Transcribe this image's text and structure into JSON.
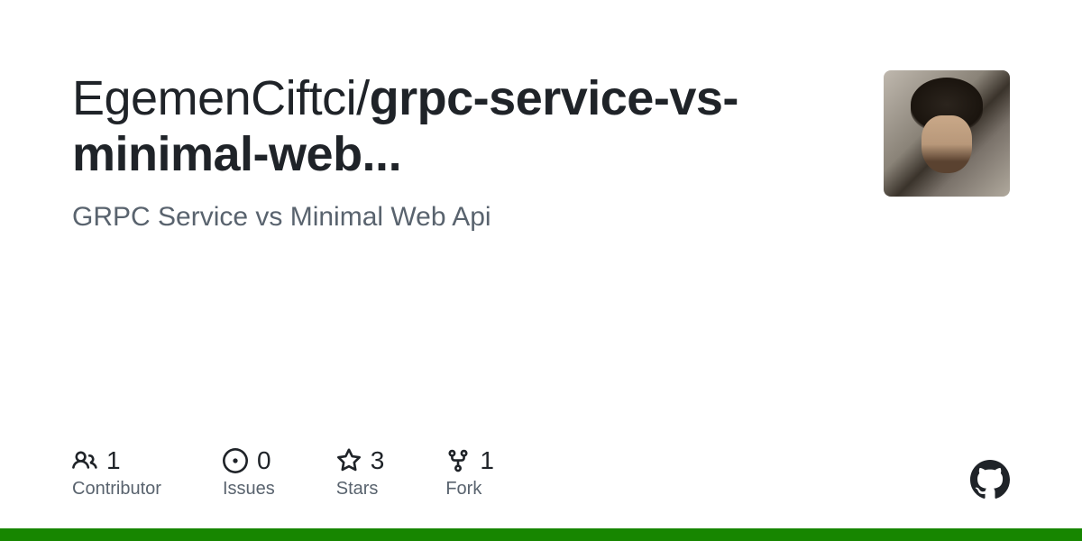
{
  "repo": {
    "owner": "EgemenCiftci",
    "separator": "/",
    "name": "grpc-service-vs-minimal-web...",
    "description": "GRPC Service vs Minimal Web Api"
  },
  "stats": {
    "contributors": {
      "value": "1",
      "label": "Contributor"
    },
    "issues": {
      "value": "0",
      "label": "Issues"
    },
    "stars": {
      "value": "3",
      "label": "Stars"
    },
    "forks": {
      "value": "1",
      "label": "Fork"
    }
  },
  "accent_color": "#178600"
}
